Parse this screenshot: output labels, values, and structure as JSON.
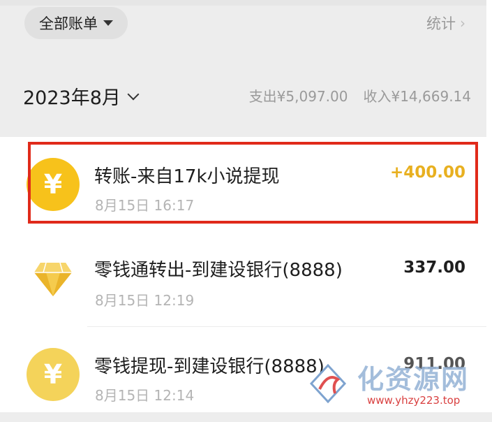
{
  "header": {
    "filter_label": "全部账单",
    "stats_label": "统计"
  },
  "period": {
    "month_label": "2023年8月",
    "expense_summary": "支出¥5,097.00",
    "income_summary": "收入¥14,669.14"
  },
  "transactions": [
    {
      "icon": "yuan-coin-icon",
      "title": "转账-来自17k小说提现",
      "time": "8月15日 16:17",
      "amount": "+400.00",
      "highlighted": true,
      "amount_color": "#e8b020"
    },
    {
      "icon": "diamond-icon",
      "title": "零钱通转出-到建设银行(8888)",
      "time": "8月15日 12:19",
      "amount": "337.00"
    },
    {
      "icon": "yuan-coin-icon",
      "title": "零钱提现-到建设银行(8888)",
      "time": "8月15日 12:14",
      "amount": "911.00"
    }
  ],
  "colors": {
    "highlight_border": "#e02a1a",
    "coin": "#f7c21b"
  },
  "watermark": {
    "text": "化资源网",
    "url": "www.yhzy223.top"
  }
}
